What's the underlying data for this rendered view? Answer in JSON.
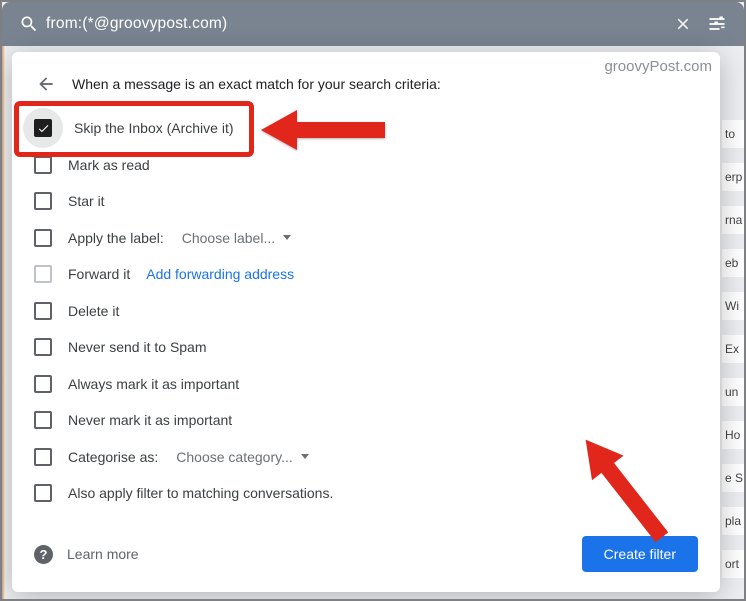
{
  "search": {
    "query": "from:(*@groovypost.com)"
  },
  "watermark": "groovyPost.com",
  "header": "When a message is an exact match for your search criteria:",
  "options": {
    "skip_inbox": "Skip the Inbox (Archive it)",
    "mark_read": "Mark as read",
    "star": "Star it",
    "apply_label_prefix": "Apply the label:",
    "apply_label_value": "Choose label...",
    "forward": "Forward it",
    "forward_link": "Add forwarding address",
    "delete": "Delete it",
    "never_spam": "Never send it to Spam",
    "always_important": "Always mark it as important",
    "never_important": "Never mark it as important",
    "categorise_prefix": "Categorise as:",
    "categorise_value": "Choose category...",
    "also_apply": "Also apply filter to matching conversations."
  },
  "footer": {
    "learn_more": "Learn more",
    "create": "Create filter"
  },
  "bg_peeks": [
    "to",
    "erp",
    "rna",
    "eb",
    "Wi",
    "Ex",
    "un",
    "Ho",
    "e S",
    "pla",
    "ort"
  ]
}
